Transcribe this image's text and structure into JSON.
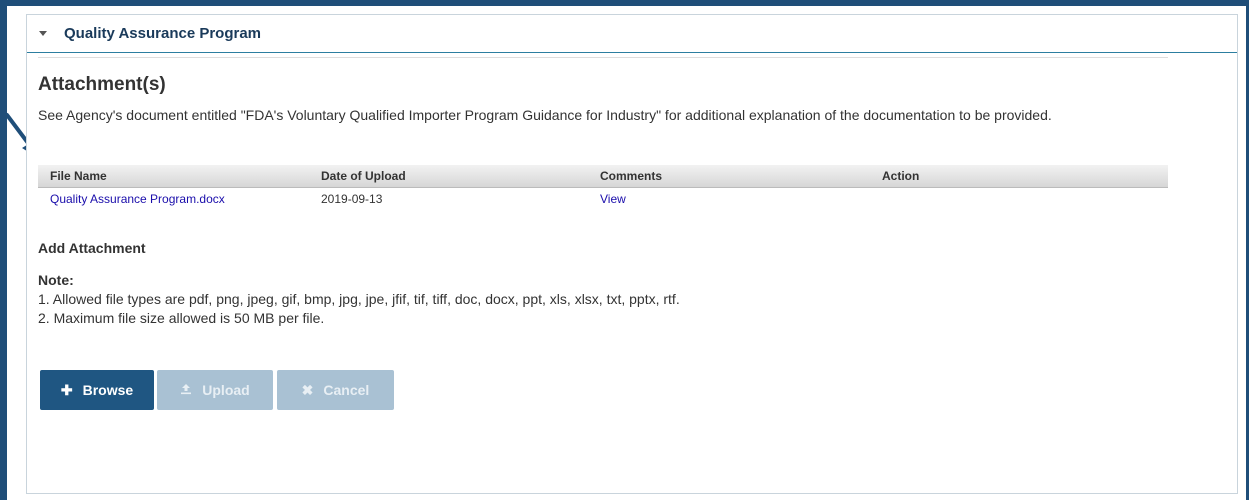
{
  "panel": {
    "title": "Quality Assurance Program"
  },
  "attachments": {
    "heading": "Attachment(s)",
    "description": "See Agency's document entitled \"FDA's Voluntary Qualified Importer Program Guidance for Industry\" for additional explanation of the documentation to be provided.",
    "columns": [
      "File Name",
      "Date of Upload",
      "Comments",
      "Action"
    ],
    "rows": [
      {
        "file_name": "Quality Assurance Program.docx",
        "date": "2019-09-13",
        "comments": "View",
        "action": ""
      }
    ]
  },
  "add_attachment": {
    "heading": "Add Attachment",
    "note_label": "Note:",
    "notes": [
      "1. Allowed file types are pdf, png, jpeg, gif, bmp, jpg, jpe, jfif, tif, tiff, doc, docx, ppt, xls, xlsx, txt, pptx, rtf.",
      "2. Maximum file size allowed is 50 MB per file."
    ]
  },
  "buttons": {
    "browse": "Browse",
    "upload": "Upload",
    "cancel": "Cancel"
  },
  "icons": {
    "panel_toggle": "caret-down-icon",
    "annotation": "arrow-icon",
    "browse": "plus-icon",
    "upload": "upload-icon",
    "cancel": "close-icon"
  },
  "colors": {
    "frame": "#1f4e79",
    "primary_button": "#1f5682",
    "disabled_button": "#a9c1d3",
    "link": "#1a0dab"
  }
}
